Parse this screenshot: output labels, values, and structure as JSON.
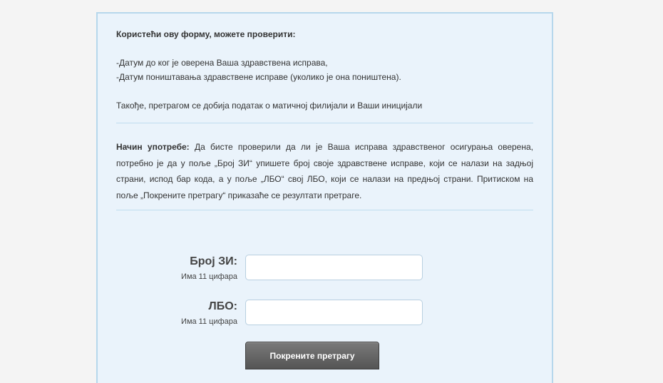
{
  "intro": {
    "title": "Користећи ову форму, можете проверити:",
    "items": [
      "-Датум до ког је оверена Ваша здравствена исправа,",
      "-Датум поништавања здравствене исправе (уколико је она поништена)."
    ],
    "also": "Такође, претрагом се добија податак о матичној филијали и Ваши иницијали"
  },
  "usage": {
    "label": "Начин употребе:",
    "text": " Да бисте проверили да ли је Ваша исправа здравственог осигурања оверена, потребно је да у поље „Број ЗИ“ упишете број своје здравствене исправе, који се налази на задњој страни, испод бар кода,  а у поље „ЛБО“ свој ЛБО, који се налази на предњој страни. Притиском на поље „Покрените претрагу“ приказаће се резултати претраге."
  },
  "form": {
    "zi": {
      "label": "Број ЗИ:",
      "hint": "Има 11 цифара",
      "value": ""
    },
    "lbo": {
      "label": "ЛБО:",
      "hint": "Има 11 цифара",
      "value": ""
    },
    "submit_label": "Покрените претрагу"
  },
  "colors": {
    "panel_bg": "#eaf3fb",
    "panel_border": "#b6d7ec",
    "button_bg": "#5f5f5f"
  }
}
